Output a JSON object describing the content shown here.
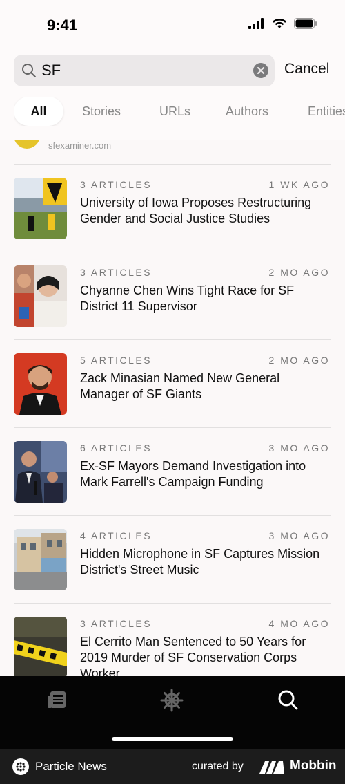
{
  "status": {
    "time": "9:41"
  },
  "search": {
    "query": "SF",
    "cancel_label": "Cancel"
  },
  "tabs": [
    "All",
    "Stories",
    "URLs",
    "Authors",
    "Entities"
  ],
  "prev_item": {
    "source": "sfexaminer.com"
  },
  "articles": [
    {
      "count": "3 ARTICLES",
      "time": "1 WK AGO",
      "headline": "University of Iowa Proposes Restructuring Gender and Social Justice Studies"
    },
    {
      "count": "3 ARTICLES",
      "time": "2 MO AGO",
      "headline": "Chyanne Chen Wins Tight Race for SF District 11 Supervisor"
    },
    {
      "count": "5 ARTICLES",
      "time": "2 MO AGO",
      "headline": "Zack Minasian Named New General Manager of SF Giants"
    },
    {
      "count": "6 ARTICLES",
      "time": "3 MO AGO",
      "headline": "Ex-SF Mayors Demand Investigation into Mark Farrell's Campaign Funding"
    },
    {
      "count": "4 ARTICLES",
      "time": "3 MO AGO",
      "headline": "Hidden Microphone in SF Captures Mission District's Street Music"
    },
    {
      "count": "3 ARTICLES",
      "time": "4 MO AGO",
      "headline": "El Cerrito Man Sentenced to 50 Years for 2019 Murder of SF Conservation Corps Worker"
    }
  ],
  "tab_bar": {
    "icons": [
      "news-icon",
      "helm-icon",
      "search-icon"
    ]
  },
  "footer": {
    "app_name": "Particle News",
    "curated": "curated by",
    "brand": "Mobbin"
  }
}
